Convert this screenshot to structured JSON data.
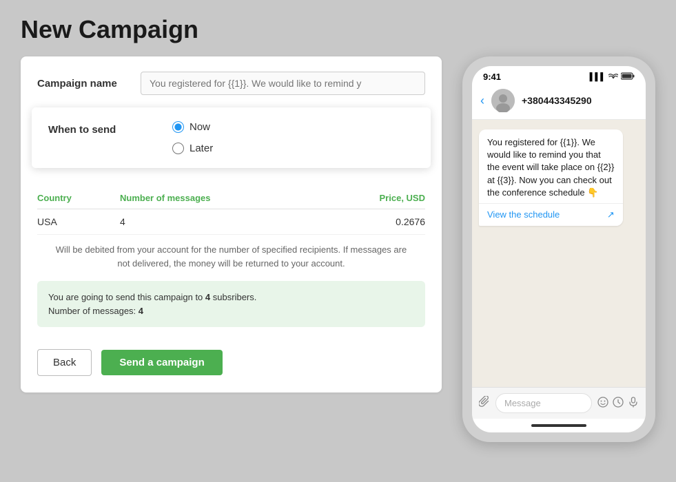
{
  "page": {
    "title": "New Campaign"
  },
  "campaign_form": {
    "campaign_name_label": "Campaign name",
    "campaign_name_placeholder": "You registered for {{1}}. We would like to remind y",
    "when_to_send_label": "When to send",
    "radio_now_label": "Now",
    "radio_later_label": "Later",
    "table": {
      "col_country": "Country",
      "col_messages": "Number of messages",
      "col_price": "Price, USD",
      "rows": [
        {
          "country": "USA",
          "messages": "4",
          "price": "0.2676"
        }
      ]
    },
    "debit_note": "Will be debited from your account for the number of specified recipients. If messages are not delivered, the money will be returned to your account.",
    "info_box_line1": "You are going to send this campaign to",
    "info_subscribers_count": "4",
    "info_box_label": "subsribers.",
    "info_box_line2": "Number of messages:",
    "info_messages_count": "4",
    "back_button": "Back",
    "send_button": "Send a campaign"
  },
  "phone": {
    "status_time": "9:41",
    "signal_icon": "▌▌▌",
    "wifi_icon": "WiFi",
    "battery_icon": "🔋",
    "back_arrow": "‹",
    "contact_name": "+380443345290",
    "message_text": "You registered for {{1}}. We would like to remind you that the event will take place on {{2}} at {{3}}. Now you can check out the conference schedule 👇",
    "view_schedule_label": "View the schedule",
    "view_schedule_arrow": "↗",
    "message_placeholder": "Message",
    "attachment_icon": "📎",
    "emoji_icon": "😊",
    "clock_icon": "⏱",
    "mic_icon": "🎤"
  }
}
